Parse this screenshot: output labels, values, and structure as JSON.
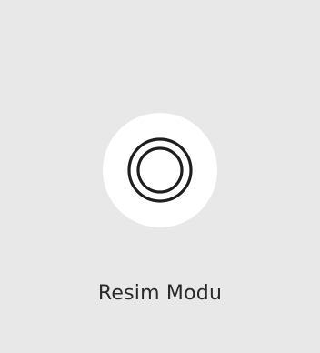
{
  "tile": {
    "label": "Resim Modu",
    "icon": "picture-mode-icon",
    "colors": {
      "background": "#e8e8e8",
      "icon_circle": "#ffffff",
      "icon_stroke": "#1e1e1e",
      "label_text": "#2a2a2a"
    }
  }
}
